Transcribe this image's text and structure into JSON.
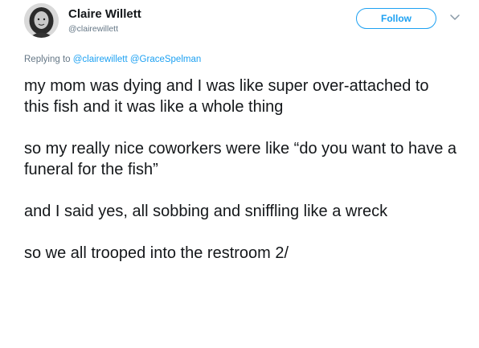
{
  "user": {
    "name": "Claire Willett",
    "handle": "@clairewillett"
  },
  "follow_button": {
    "label": "Follow"
  },
  "reply": {
    "prefix": "Replying to",
    "mentions": [
      "@clairewillett",
      "@GraceSpelman"
    ]
  },
  "tweet": {
    "paragraphs": [
      "my mom was dying and I was like super over-attached to this fish and it was like a whole thing",
      "so my really nice coworkers were like “do you want to have a funeral for the fish”",
      "and I said yes, all sobbing and sniffling like a wreck",
      "so we all trooped into the restroom 2/"
    ]
  },
  "icons": {
    "more": "chevron-down-icon"
  },
  "colors": {
    "accent": "#1da1f2",
    "text": "#14171a",
    "muted": "#657786"
  }
}
